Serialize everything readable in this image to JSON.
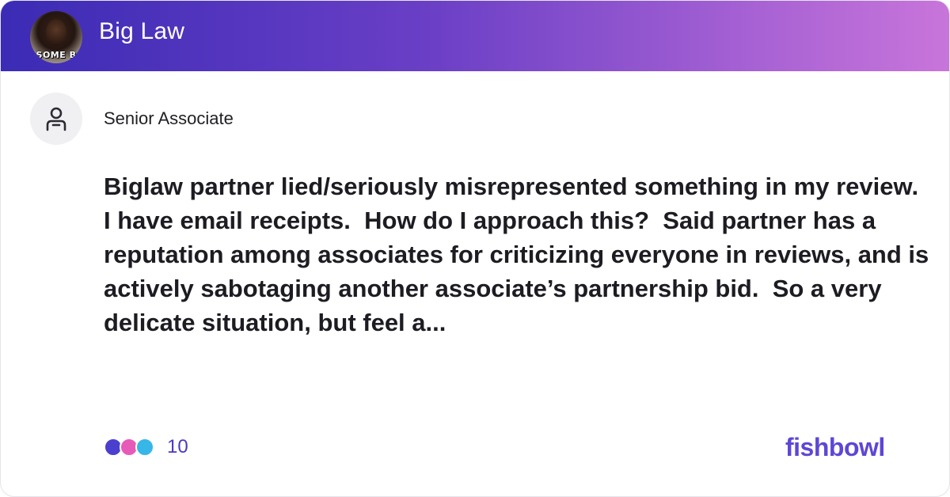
{
  "header": {
    "bowl_name": "Big Law",
    "avatar_caption": "SOME B"
  },
  "post": {
    "author_title": "Senior Associate",
    "body": "Biglaw partner lied/seriously misrepresented something in my review.  I have email receipts.  How do I approach this?  Said partner has a reputation among associates for criticizing everyone in reviews, and is actively sabotaging another associate’s partnership bid.  So a very delicate situation, but feel a..."
  },
  "reactions": {
    "count": "10",
    "icons": [
      "like-icon",
      "star-icon",
      "heart-icon"
    ],
    "colors": [
      "#4b3fcf",
      "#e85ab8",
      "#37b6e8"
    ]
  },
  "brand": {
    "logo_text": "fishbowl",
    "colors": {
      "header_start": "#3b2bb5",
      "header_end": "#c875da",
      "accent": "#5e46d6"
    }
  }
}
